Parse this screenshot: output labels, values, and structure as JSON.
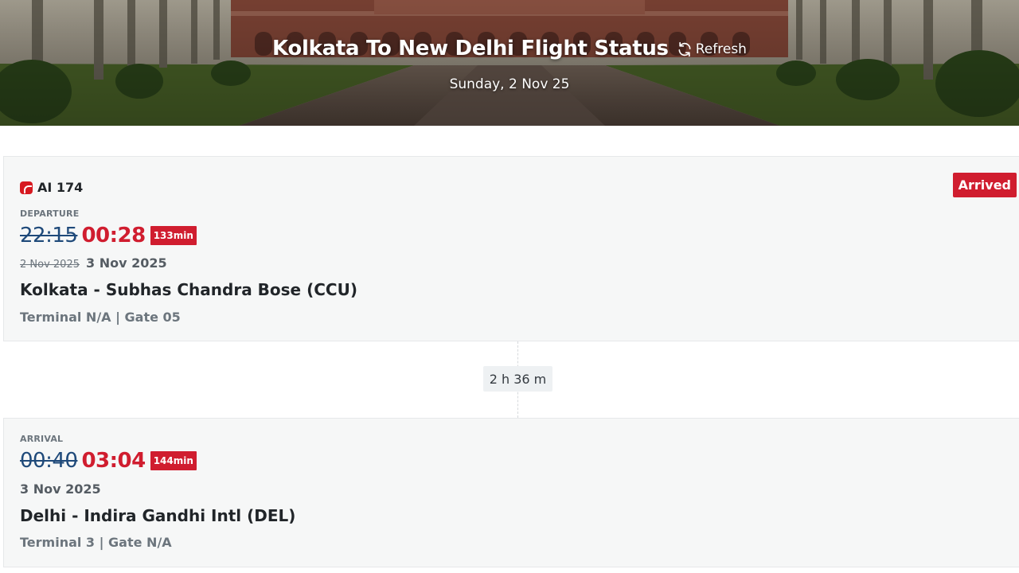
{
  "header": {
    "title": "Kolkata To New Delhi Flight Status",
    "refresh_label": "Refresh",
    "refresh_icon": "refresh-icon",
    "date": "Sunday, 2 Nov 25"
  },
  "flight": {
    "number": "AI 174",
    "airline_logo": "air-india-logo",
    "status": "Arrived"
  },
  "departure": {
    "label": "DEPARTURE",
    "scheduled_time": "22:15",
    "actual_time": "00:28",
    "delay": "133min",
    "scheduled_date": "2 Nov 2025",
    "actual_date": "3 Nov 2025",
    "airport": "Kolkata - Subhas Chandra Bose (CCU)",
    "terminal_gate": "Terminal N/A | Gate 05"
  },
  "duration": "2 h 36 m",
  "arrival": {
    "label": "ARRIVAL",
    "scheduled_time": "00:40",
    "actual_time": "03:04",
    "delay": "144min",
    "actual_date": "3 Nov 2025",
    "airport": "Delhi - Indira Gandhi Intl (DEL)",
    "terminal_gate": "Terminal 3 | Gate N/A"
  },
  "colors": {
    "accent_red": "#d01d2f",
    "scheduled_blue": "#1f4a7a",
    "card_bg": "#f6f7f7"
  }
}
